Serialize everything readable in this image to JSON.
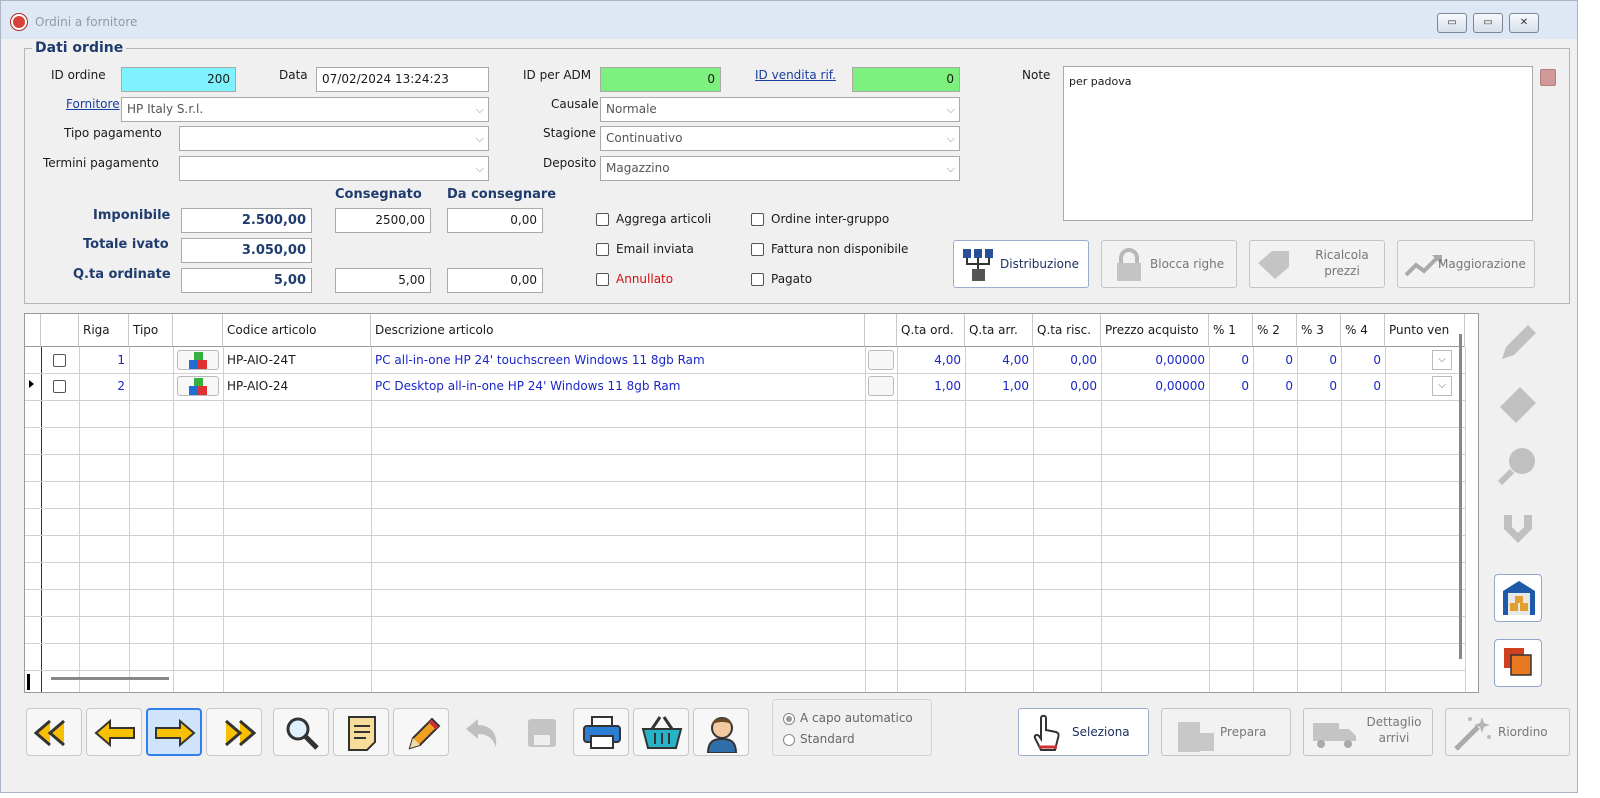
{
  "window": {
    "title": "Ordini a fornitore",
    "controls": [
      "▭",
      "▭",
      "✕"
    ]
  },
  "order": {
    "group_title": "Dati ordine",
    "id_ordine_label": "ID ordine",
    "id_ordine": "200",
    "data_label": "Data",
    "data": "07/02/2024 13:24:23",
    "id_adm_label": "ID per ADM",
    "id_adm": "0",
    "id_vendita_label": "ID vendita rif.",
    "id_vendita": "0",
    "note_label": "Note",
    "note": "per padova",
    "fornitore_label": "Fornitore",
    "fornitore": "HP Italy S.r.l.",
    "causale_label": "Causale",
    "causale": "Normale",
    "tipo_pagamento_label": "Tipo pagamento",
    "tipo_pagamento": "",
    "stagione_label": "Stagione",
    "stagione": "Continuativo",
    "termini_pagamento_label": "Termini pagamento",
    "termini_pagamento": "",
    "deposito_label": "Deposito",
    "deposito": "Magazzino"
  },
  "totals": {
    "consegnato_label": "Consegnato",
    "da_consegnare_label": "Da consegnare",
    "imponibile_label": "Imponibile",
    "imponibile": "2.500,00",
    "consegnato": "2500,00",
    "da_consegnare": "0,00",
    "totale_ivato_label": "Totale ivato",
    "totale_ivato": "3.050,00",
    "qta_ordinate_label": "Q.ta ordinate",
    "qta_ordinate": "5,00",
    "qta_consegnato": "5,00",
    "qta_da_consegnare": "0,00"
  },
  "checkboxes": {
    "aggrega": "Aggrega articoli",
    "email": "Email inviata",
    "annullato": "Annullato",
    "inter_gruppo": "Ordine inter-gruppo",
    "fattura": "Fattura non disponibile",
    "pagato": "Pagato"
  },
  "actions": {
    "distribuzione": "Distribuzione",
    "blocca": "Blocca righe",
    "ricalcola_1": "Ricalcola",
    "ricalcola_2": "prezzi",
    "maggiorazione": "Maggiorazione"
  },
  "grid": {
    "columns": [
      "Riga",
      "Tipo",
      "",
      "Codice articolo",
      "Descrizione articolo",
      "",
      "Q.ta ord.",
      "Q.ta arr.",
      "Q.ta risc.",
      "Prezzo acquisto",
      "% 1",
      "% 2",
      "% 3",
      "% 4",
      "Punto ven"
    ],
    "rows": [
      {
        "riga": "1",
        "codice": "HP-AIO-24T",
        "descrizione": "PC all-in-one HP 24' touchscreen Windows 11 8gb Ram",
        "qta_ord": "4,00",
        "qta_arr": "4,00",
        "qta_risc": "0,00",
        "prezzo": "0,00000",
        "p1": "0",
        "p2": "0",
        "p3": "0",
        "p4": "0"
      },
      {
        "riga": "2",
        "codice": "HP-AIO-24",
        "descrizione": "PC Desktop all-in-one HP 24' Windows 11 8gb Ram",
        "qta_ord": "1,00",
        "qta_arr": "1,00",
        "qta_risc": "0,00",
        "prezzo": "0,00000",
        "p1": "0",
        "p2": "0",
        "p3": "0",
        "p4": "0"
      }
    ]
  },
  "wrap_options": {
    "auto": "A capo automatico",
    "standard": "Standard",
    "selected": "A capo automatico"
  },
  "bottom_actions": {
    "seleziona": "Seleziona",
    "prepara": "Prepara",
    "dettaglio_1": "Dettaglio",
    "dettaglio_2": "arrivi",
    "riordino": "Riordino"
  },
  "colors": {
    "cyan_field": "#7ff2ff",
    "green_field": "#7ef07e",
    "label_blue": "#1f3c6e",
    "grid_text_blue": "#1a26c8",
    "annullato_red": "#d01010"
  }
}
